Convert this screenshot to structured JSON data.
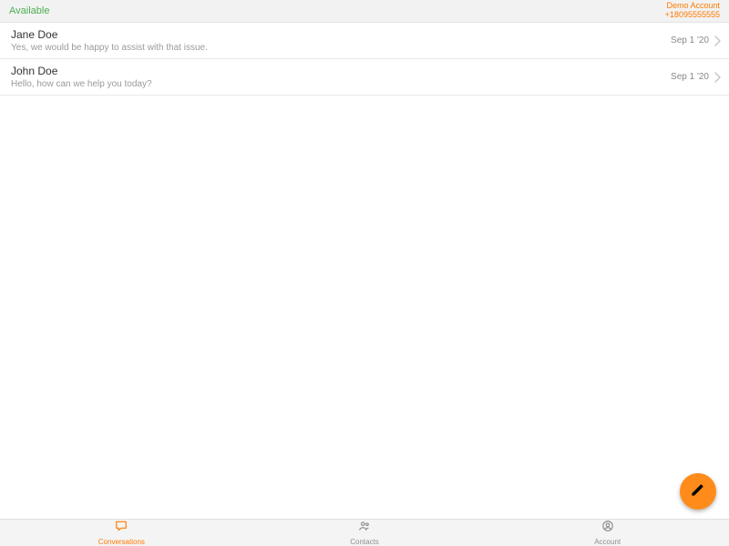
{
  "header": {
    "status": "Available",
    "account_name": "Demo Account",
    "account_phone": "+18095555555"
  },
  "conversations": [
    {
      "name": "Jane Doe",
      "preview": "Yes, we would be happy to assist with that issue.",
      "date": "Sep 1 '20"
    },
    {
      "name": "John Doe",
      "preview": "Hello, how can we help you today?",
      "date": "Sep 1 '20"
    }
  ],
  "tabs": {
    "conversations": "Conversations",
    "contacts": "Contacts",
    "account": "Account"
  }
}
